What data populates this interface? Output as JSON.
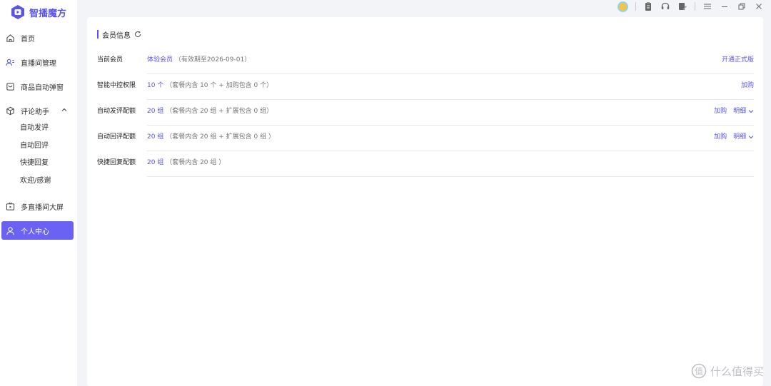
{
  "app": {
    "name": "智播魔方"
  },
  "nav": {
    "home": "首页",
    "live_manage": "直播间管理",
    "product_popup": "商品自动弹窗",
    "comment_assistant": "评论助手",
    "comment_sub": [
      "自动发评",
      "自动回评",
      "快捷回复",
      "欢迎/感谢"
    ],
    "multi_screen": "多直播间大屏",
    "personal_center": "个人中心"
  },
  "section": {
    "title": "会员信息"
  },
  "rows": [
    {
      "label": "当前会员",
      "value": "体验会员",
      "detail": "（有效期至2026-09-01）",
      "actions": [
        "开通正式版"
      ]
    },
    {
      "label": "智能中控权限",
      "value": "10 个",
      "detail": "（套餐内含 10 个 + 加购包含 0 个）",
      "actions": [
        "加购"
      ]
    },
    {
      "label": "自动发评配额",
      "value": "20 组",
      "detail": "（套餐内含 20 组 + 扩展包含 0 组）",
      "actions": [
        "加购",
        "明细"
      ]
    },
    {
      "label": "自动回评配额",
      "value": "20 组",
      "detail": "（套餐内含 20 组 + 扩展包含 0 组 ）",
      "actions": [
        "加购",
        "明细"
      ]
    },
    {
      "label": "快捷回复配额",
      "value": "20 组",
      "detail": "（套餐内含 20 组 ）",
      "actions": []
    }
  ],
  "watermark": {
    "text": "什么值得买"
  },
  "colors": {
    "accent": "#5a55e6",
    "active_bg": "#6a62f2"
  }
}
